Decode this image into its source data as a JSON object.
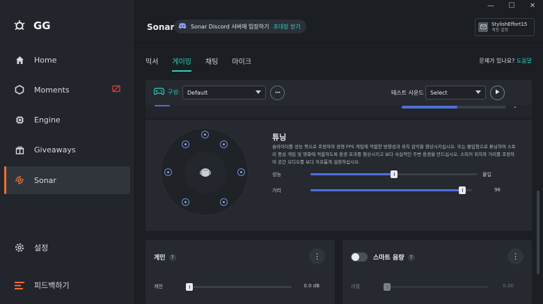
{
  "app": {
    "logo_text": "GG"
  },
  "sidebar": {
    "items": [
      {
        "label": "Home",
        "icon": "home-icon"
      },
      {
        "label": "Moments",
        "icon": "hexagon-icon"
      },
      {
        "label": "Engine",
        "icon": "chip-icon"
      },
      {
        "label": "Giveaways",
        "icon": "gift-icon"
      },
      {
        "label": "Sonar",
        "icon": "sonar-icon",
        "active": true
      }
    ],
    "settings_label": "설정",
    "feedback_label": "피드백하기"
  },
  "header": {
    "title": "Sonar",
    "discord_text": "Sonar Discord 서버에 입장하기",
    "discord_link": "초대장 받기",
    "user_name": "StylishEffort15",
    "user_sub": "계정 설정"
  },
  "tabs": [
    "믹서",
    "게이밍",
    "채팅",
    "마이크"
  ],
  "active_tab": 1,
  "help": {
    "text": "문제가 있나요?",
    "link": "도움말"
  },
  "config": {
    "label": "구성:",
    "preset": "Default",
    "more": "•••",
    "test_label": "테스트 사운드",
    "test_value": "Select"
  },
  "tuning": {
    "title": "튜닝",
    "description": "슬라이더를 성능 쪽으로 조정하여 경쟁 FPS 게임에 적합한 방향성과 위치 감각을 향상시키십시오. 또는 몰입형으로 튜닝하여 스토리 중심 게임 및 영화에 적합하도록 환경 효과를 향상시키고 보다 사실적인 주변 환경을 만드십시오. 스피커 위치와 거리를 조정하여 공간 오디오를 보다 자유롭게 설정하십시오.",
    "slider1": {
      "label": "성능",
      "right_label": "몰입",
      "value": 0.5
    },
    "slider2": {
      "label": "거리",
      "value_text": "96",
      "value": 0.96
    }
  },
  "gain_card": {
    "title": "게인",
    "q": "?",
    "slider_label": "게인",
    "value_text": "0.0 dB",
    "value": 0.0
  },
  "smart_card": {
    "title": "스마트 음량",
    "q": "?",
    "slider_label": "레벨",
    "value_text": "0.00",
    "value": 0.0
  },
  "colors": {
    "accent": "#2bd4be",
    "active_bar": "#f26c2c",
    "slider_fill": "#4f6fd8"
  }
}
